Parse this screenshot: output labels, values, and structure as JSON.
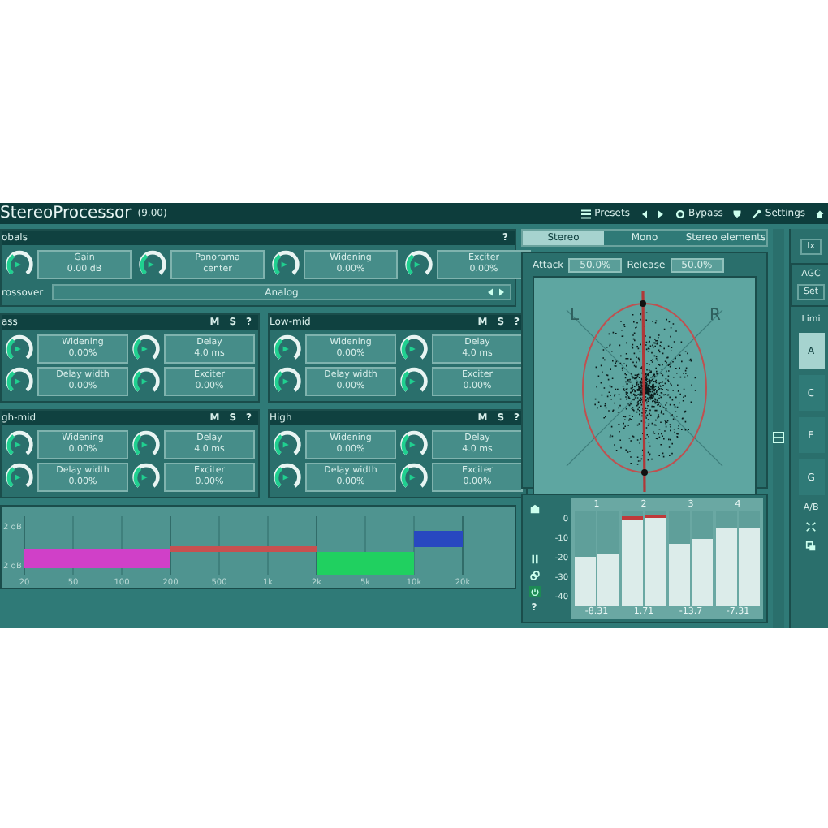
{
  "title_bar": {
    "app_name": "StereoProcessor",
    "version": "(9.00)",
    "presets": "Presets",
    "bypass": "Bypass",
    "settings": "Settings"
  },
  "globals": {
    "title": "obals",
    "help": "?",
    "controls": [
      {
        "label": "Gain",
        "value": "0.00 dB"
      },
      {
        "label": "Panorama",
        "value": "center"
      },
      {
        "label": "Widening",
        "value": "0.00%"
      },
      {
        "label": "Exciter",
        "value": "0.00%"
      }
    ],
    "crossover_label": "rossover",
    "crossover_value": "Analog"
  },
  "bands": [
    {
      "title": "ass",
      "mute": "M",
      "solo": "S",
      "help": "?",
      "controls": [
        {
          "label": "Widening",
          "value": "0.00%"
        },
        {
          "label": "Delay",
          "value": "4.0 ms"
        },
        {
          "label": "Delay width",
          "value": "0.00%"
        },
        {
          "label": "Exciter",
          "value": "0.00%"
        }
      ]
    },
    {
      "title": "Low-mid",
      "mute": "M",
      "solo": "S",
      "help": "?",
      "controls": [
        {
          "label": "Widening",
          "value": "0.00%"
        },
        {
          "label": "Delay",
          "value": "4.0 ms"
        },
        {
          "label": "Delay width",
          "value": "0.00%"
        },
        {
          "label": "Exciter",
          "value": "0.00%"
        }
      ]
    },
    {
      "title": "gh-mid",
      "mute": "M",
      "solo": "S",
      "help": "?",
      "controls": [
        {
          "label": "Widening",
          "value": "0.00%"
        },
        {
          "label": "Delay",
          "value": "4.0 ms"
        },
        {
          "label": "Delay width",
          "value": "0.00%"
        },
        {
          "label": "Exciter",
          "value": "0.00%"
        }
      ]
    },
    {
      "title": "High",
      "mute": "M",
      "solo": "S",
      "help": "?",
      "controls": [
        {
          "label": "Widening",
          "value": "0.00%"
        },
        {
          "label": "Delay",
          "value": "4.0 ms"
        },
        {
          "label": "Delay width",
          "value": "0.00%"
        },
        {
          "label": "Exciter",
          "value": "0.00%"
        }
      ]
    }
  ],
  "crossover_graph": {
    "y_labels": [
      "2 dB",
      "2 dB"
    ],
    "x_labels": [
      "20",
      "50",
      "100",
      "200",
      "500",
      "1k",
      "2k",
      "5k",
      "10k",
      "20k"
    ],
    "bands": [
      {
        "color": "#d040c8"
      },
      {
        "color": "#c85050"
      },
      {
        "color": "#20d060"
      },
      {
        "color": "#2848c0"
      }
    ]
  },
  "scope": {
    "tabs": [
      {
        "label": "Stereo",
        "selected": true
      },
      {
        "label": "Mono",
        "selected": false
      },
      {
        "label": "Stereo elements",
        "selected": false
      }
    ],
    "attack_label": "Attack",
    "attack_value": "50.0%",
    "release_label": "Release",
    "release_value": "50.0%",
    "left_label": "L",
    "right_label": "R"
  },
  "meter": {
    "help": "?",
    "power_on": true,
    "scale": [
      "0",
      "-10",
      "-20",
      "-30",
      "-40"
    ],
    "channels": [
      {
        "label": "1",
        "reading": "-8.31",
        "clipped": false,
        "bars": [
          {
            "level": 0.52
          },
          {
            "level": 0.55
          }
        ]
      },
      {
        "label": "2",
        "reading": "1.71",
        "clipped": true,
        "bars": [
          {
            "level": 0.95
          },
          {
            "level": 0.97
          }
        ]
      },
      {
        "label": "3",
        "reading": "-13.7",
        "clipped": false,
        "bars": [
          {
            "level": 0.66
          },
          {
            "level": 0.7
          }
        ]
      },
      {
        "label": "4",
        "reading": "-7.31",
        "clipped": false,
        "bars": [
          {
            "level": 0.83
          },
          {
            "level": 0.83
          }
        ]
      }
    ]
  },
  "side_strip": {
    "top_label": "Ix",
    "agc_label": "AGC",
    "agc_button": "Set",
    "limiter_label": "Limi",
    "slots": [
      {
        "label": "A",
        "selected": true
      },
      {
        "label": "C",
        "selected": false
      },
      {
        "label": "E",
        "selected": false
      },
      {
        "label": "G",
        "selected": false
      }
    ],
    "ab_label": "A/B"
  }
}
